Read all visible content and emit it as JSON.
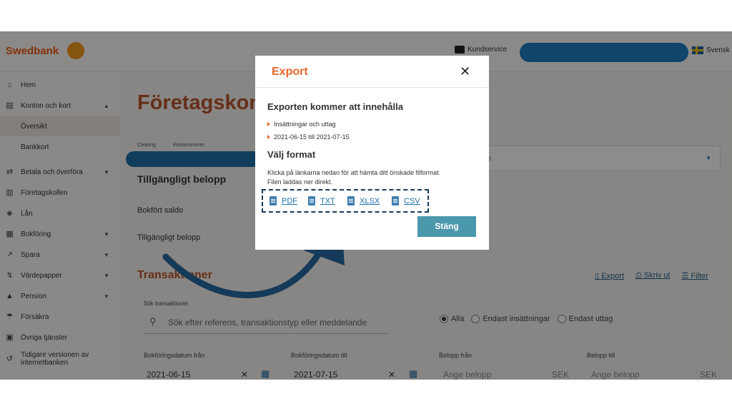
{
  "header": {
    "logo_text": "Swedbank",
    "customer_service": "Kundservice",
    "language": "Svensk"
  },
  "sidebar": {
    "items": [
      {
        "label": "Hem",
        "icon": "home-icon"
      },
      {
        "label": "Konton och kort",
        "icon": "card-icon",
        "expanded": true
      },
      {
        "label": "Översikt",
        "sub": true,
        "active": true
      },
      {
        "label": "Bankkort",
        "sub": true
      },
      {
        "label": "Betala och överföra",
        "icon": "transfer-icon"
      },
      {
        "label": "Företagskollen",
        "icon": "chart-icon"
      },
      {
        "label": "Lån",
        "icon": "loan-icon"
      },
      {
        "label": "Bokföring",
        "icon": "ledger-icon"
      },
      {
        "label": "Spara",
        "icon": "savings-icon"
      },
      {
        "label": "Värdepapper",
        "icon": "securities-icon"
      },
      {
        "label": "Pension",
        "icon": "pension-icon"
      },
      {
        "label": "Försäkra",
        "icon": "umbrella-icon"
      },
      {
        "label": "Övriga tjänster",
        "icon": "grid-icon"
      },
      {
        "label": "Tidigare versionen av internetbanken",
        "icon": "history-icon"
      }
    ]
  },
  "main": {
    "title": "Företagskon",
    "account_tabs": [
      "Clearing",
      "Kontonummer"
    ],
    "available_heading": "Tillgängligt belopp",
    "booked_balance_label": "Bokfört saldo",
    "available_amount_label": "Tillgängligt belopp",
    "select_text": "o",
    "transactions_title": "Transaktioner",
    "actions": {
      "export": "Export",
      "print": "Skriv ut",
      "filter": "Filter"
    },
    "search": {
      "label": "Sök transaktioner",
      "placeholder": "Sök efter referens, transaktionstyp eller meddelande"
    },
    "radio": {
      "all": "Alla",
      "deposits": "Endast insättningar",
      "withdrawals": "Endast uttag"
    },
    "filters": {
      "from_date_label": "Bokföringsdatum från",
      "from_date_value": "2021-06-15",
      "to_date_label": "Bokföringsdatum till",
      "to_date_value": "2021-07-15",
      "amount_from_label": "Belopp från",
      "amount_from_placeholder": "Ange belopp",
      "amount_to_label": "Belopp till",
      "amount_to_placeholder": "Ange belopp",
      "currency": "SEK"
    }
  },
  "modal": {
    "title": "Export",
    "contents_heading": "Exporten kommer att innehålla",
    "contents_items": [
      "Insättningar och uttag",
      "2021-06-15 till 2021-07-15"
    ],
    "format_heading": "Välj format",
    "instructions_line1": "Klicka på länkarna nedan för att hämta ditt önskade filformat.",
    "instructions_line2": "Filen laddas ner direkt.",
    "formats": [
      "PDF",
      "TXT",
      "XLSX",
      "CSV"
    ],
    "close_button": "Stäng"
  },
  "colors": {
    "brand_orange": "#e8642c",
    "link_blue": "#1f6fa8",
    "button_teal": "#4b98ad",
    "annotation_navy": "#163a59"
  }
}
